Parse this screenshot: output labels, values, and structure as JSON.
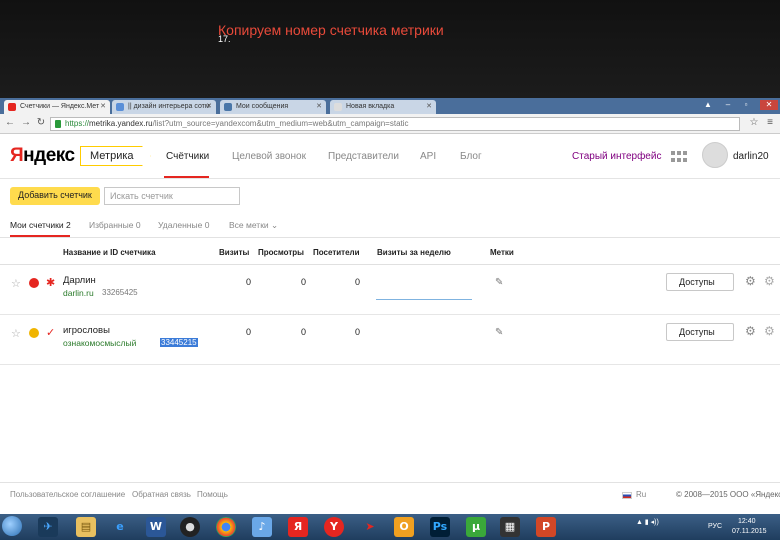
{
  "slide": {
    "number": "17.",
    "title": "Копируем номер счетчика метрики"
  },
  "browser": {
    "tabs": [
      {
        "label": "Счетчики — Яндекс.Мет",
        "color": "#e52620"
      },
      {
        "label": "|| дизайн интерьера сотм",
        "color": "#5a8fd8"
      },
      {
        "label": "Мои сообщения",
        "color": "#4a76a8"
      },
      {
        "label": "Новая вкладка",
        "color": "#dddddd"
      }
    ],
    "url_prefix": "https://",
    "url_host": "metrika.yandex.ru",
    "url_rest": "/list?utm_source=yandexcom&utm_medium=web&utm_campaign=static"
  },
  "header": {
    "logo_first": "Я",
    "logo_rest": "ндекс",
    "product": "Метрика",
    "nav": [
      "Счётчики",
      "Целевой звонок",
      "Представители",
      "API",
      "Блог"
    ],
    "old_interface": "Старый интерфейс",
    "username": "darlin20"
  },
  "toolbar": {
    "add_label": "Добавить счетчик",
    "search_placeholder": "Искать счетчик"
  },
  "filters": [
    "Мои счетчики 2",
    "Избранные 0",
    "Удаленные 0",
    "Все метки"
  ],
  "table": {
    "headers": {
      "name": "Название и ID счетчика",
      "visits": "Визиты",
      "views": "Просмотры",
      "visitors": "Посетители",
      "week": "Визиты за неделю",
      "tags": "Метки"
    },
    "rows": [
      {
        "name": "Дарлин",
        "site": "darlin.ru",
        "id": "33265425",
        "visits": "0",
        "views": "0",
        "visitors": "0",
        "access": "Доступы",
        "status_color": "#e52620",
        "icon_color": "#e52620"
      },
      {
        "name": "игрословы",
        "site": "ознакомосмыслый",
        "id": "33445215",
        "visits": "0",
        "views": "0",
        "visitors": "0",
        "access": "Доступы",
        "status_color": "#f0b400",
        "icon_color": "#e52620"
      }
    ]
  },
  "footer": {
    "links": [
      "Пользовательское соглашение",
      "Обратная связь",
      "Помощь"
    ],
    "lang": "Ru",
    "copyright": "© 2008—2015 ООО «Яндекс»"
  },
  "taskbar": {
    "lang": "РУС",
    "time": "12:40",
    "date": "07.11.2015"
  }
}
